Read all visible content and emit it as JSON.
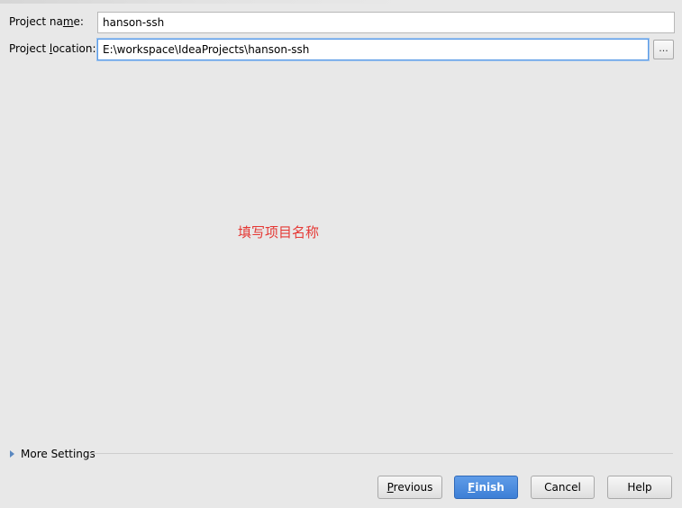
{
  "form": {
    "project_name": {
      "label_pre": "Project na",
      "label_mnemonic": "m",
      "label_post": "e:",
      "value": "hanson-ssh"
    },
    "project_location": {
      "label_pre": "Project ",
      "label_mnemonic": "l",
      "label_post": "ocation:",
      "value": "E:\\workspace\\IdeaProjects\\hanson-ssh",
      "browse_label": "..."
    }
  },
  "annotation": {
    "text": "填写项目名称",
    "color": "#e53935"
  },
  "more_settings": {
    "label": "More Settings",
    "icon": "triangle-right-icon"
  },
  "buttons": {
    "previous": {
      "mnemonic": "P",
      "rest": "revious"
    },
    "finish": {
      "mnemonic": "F",
      "rest": "inish"
    },
    "cancel": {
      "label": "Cancel"
    },
    "help": {
      "label": "Help"
    }
  },
  "colors": {
    "accent": "#4a8ae0",
    "focus_border": "#5b9be6",
    "background": "#e8e8e8"
  }
}
